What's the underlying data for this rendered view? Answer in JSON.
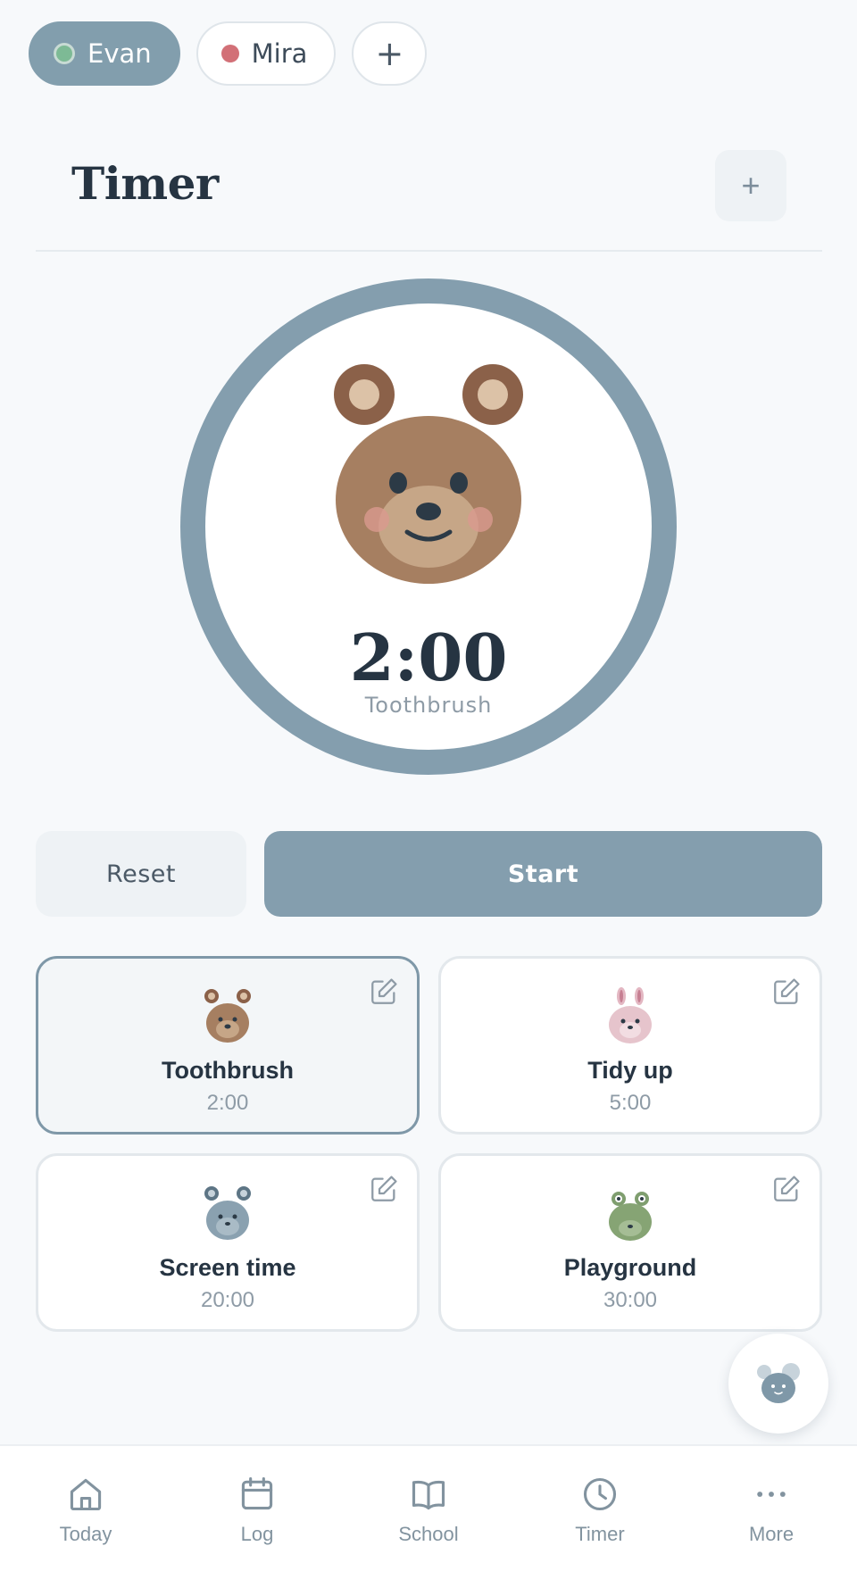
{
  "profiles": [
    {
      "name": "Evan",
      "color": "#7dba95",
      "active": true
    },
    {
      "name": "Mira",
      "color": "#d27077",
      "active": false
    }
  ],
  "add_profile_label": "+",
  "header": {
    "title": "Timer",
    "add_label": "+"
  },
  "timer": {
    "time": "2:00",
    "label": "Toothbrush",
    "animal_icon": "bear-icon",
    "ring_color": "#849eae",
    "progress": 1.0
  },
  "controls": {
    "reset_label": "Reset",
    "start_label": "Start"
  },
  "presets": [
    {
      "name": "Toothbrush",
      "duration": "2:00",
      "icon": "bear-icon",
      "selected": true
    },
    {
      "name": "Tidy up",
      "duration": "5:00",
      "icon": "bunny-icon",
      "selected": false
    },
    {
      "name": "Screen time",
      "duration": "20:00",
      "icon": "mouse-icon",
      "selected": false
    },
    {
      "name": "Playground",
      "duration": "30:00",
      "icon": "frog-icon",
      "selected": false
    }
  ],
  "fab": {
    "icon": "mascot-mouse-icon"
  },
  "nav": [
    {
      "label": "Today",
      "icon": "home-icon"
    },
    {
      "label": "Log",
      "icon": "calendar-icon"
    },
    {
      "label": "School",
      "icon": "book-icon"
    },
    {
      "label": "Timer",
      "icon": "clock-icon"
    },
    {
      "label": "More",
      "icon": "more-icon"
    }
  ],
  "colors": {
    "accent": "#849eae",
    "text": "#263442",
    "muted": "#8e9ba6",
    "background": "#f7f9fb"
  }
}
